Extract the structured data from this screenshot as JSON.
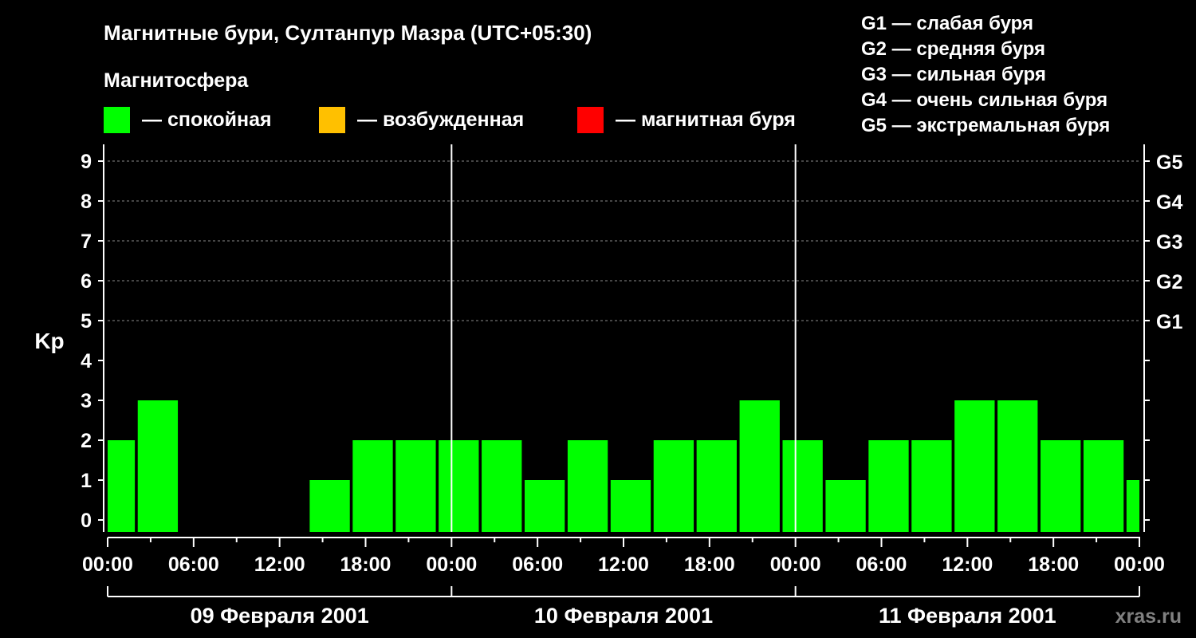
{
  "chart_data": {
    "type": "bar",
    "title": "Магнитные бури, Султанпур Мазра (UTC+05:30)",
    "legend": {
      "heading": "Магнитосфера",
      "items": [
        {
          "label": "— спокойная",
          "color": "#00ff00"
        },
        {
          "label": "— возбужденная",
          "color": "#ffc000"
        },
        {
          "label": "— магнитная буря",
          "color": "#ff0000"
        }
      ]
    },
    "g_scale_legend": [
      "G1 — слабая буря",
      "G2 — средняя буря",
      "G3 — сильная буря",
      "G4 — очень сильная буря",
      "G5 — экстремальная буря"
    ],
    "ylabel": "Kp",
    "ylim": [
      0,
      9
    ],
    "y_ticks": [
      "0",
      "1",
      "2",
      "3",
      "4",
      "5",
      "6",
      "7",
      "8",
      "9"
    ],
    "right_ticks": [
      {
        "y": 5,
        "label": "G1"
      },
      {
        "y": 6,
        "label": "G2"
      },
      {
        "y": 7,
        "label": "G3"
      },
      {
        "y": 8,
        "label": "G4"
      },
      {
        "y": 9,
        "label": "G5"
      }
    ],
    "grid": "horizontal dashed at Kp 5-9",
    "x_ticks": [
      "00:00",
      "06:00",
      "12:00",
      "18:00",
      "00:00",
      "06:00",
      "12:00",
      "18:00",
      "00:00",
      "06:00",
      "12:00",
      "18:00",
      "00:00"
    ],
    "x_tick_hours": [
      0,
      6,
      12,
      18,
      24,
      30,
      36,
      42,
      48,
      54,
      60,
      66,
      72
    ],
    "xlim_hours": [
      0,
      72
    ],
    "bar_interval_hours": 3,
    "days": [
      {
        "label": "09 Февраля 2001",
        "start_hour": 0,
        "end_hour": 24
      },
      {
        "label": "10 Февраля 2001",
        "start_hour": 24,
        "end_hour": 48
      },
      {
        "label": "11 Февраля 2001",
        "start_hour": 48,
        "end_hour": 72
      }
    ],
    "series": [
      {
        "color": "#00ff00",
        "bars": [
          {
            "start": 0,
            "end": 1.9,
            "value": 2
          },
          {
            "start": 2.1,
            "end": 4.9,
            "value": 3
          },
          {
            "start": 14.1,
            "end": 16.9,
            "value": 1
          },
          {
            "start": 17.1,
            "end": 19.9,
            "value": 2
          },
          {
            "start": 20.1,
            "end": 22.9,
            "value": 2
          },
          {
            "start": 23.1,
            "end": 25.9,
            "value": 2
          },
          {
            "start": 26.1,
            "end": 28.9,
            "value": 2
          },
          {
            "start": 29.1,
            "end": 31.9,
            "value": 1
          },
          {
            "start": 32.1,
            "end": 34.9,
            "value": 2
          },
          {
            "start": 35.1,
            "end": 37.9,
            "value": 1
          },
          {
            "start": 38.1,
            "end": 40.9,
            "value": 2
          },
          {
            "start": 41.1,
            "end": 43.9,
            "value": 2
          },
          {
            "start": 44.1,
            "end": 46.9,
            "value": 3
          },
          {
            "start": 47.1,
            "end": 49.9,
            "value": 2
          },
          {
            "start": 50.1,
            "end": 52.9,
            "value": 1
          },
          {
            "start": 53.1,
            "end": 55.9,
            "value": 2
          },
          {
            "start": 56.1,
            "end": 58.9,
            "value": 2
          },
          {
            "start": 59.1,
            "end": 61.9,
            "value": 3
          },
          {
            "start": 62.1,
            "end": 64.9,
            "value": 3
          },
          {
            "start": 65.1,
            "end": 67.9,
            "value": 2
          },
          {
            "start": 68.1,
            "end": 70.9,
            "value": 2
          },
          {
            "start": 71.1,
            "end": 72,
            "value": 1
          }
        ]
      }
    ]
  },
  "watermark": "xras.ru"
}
